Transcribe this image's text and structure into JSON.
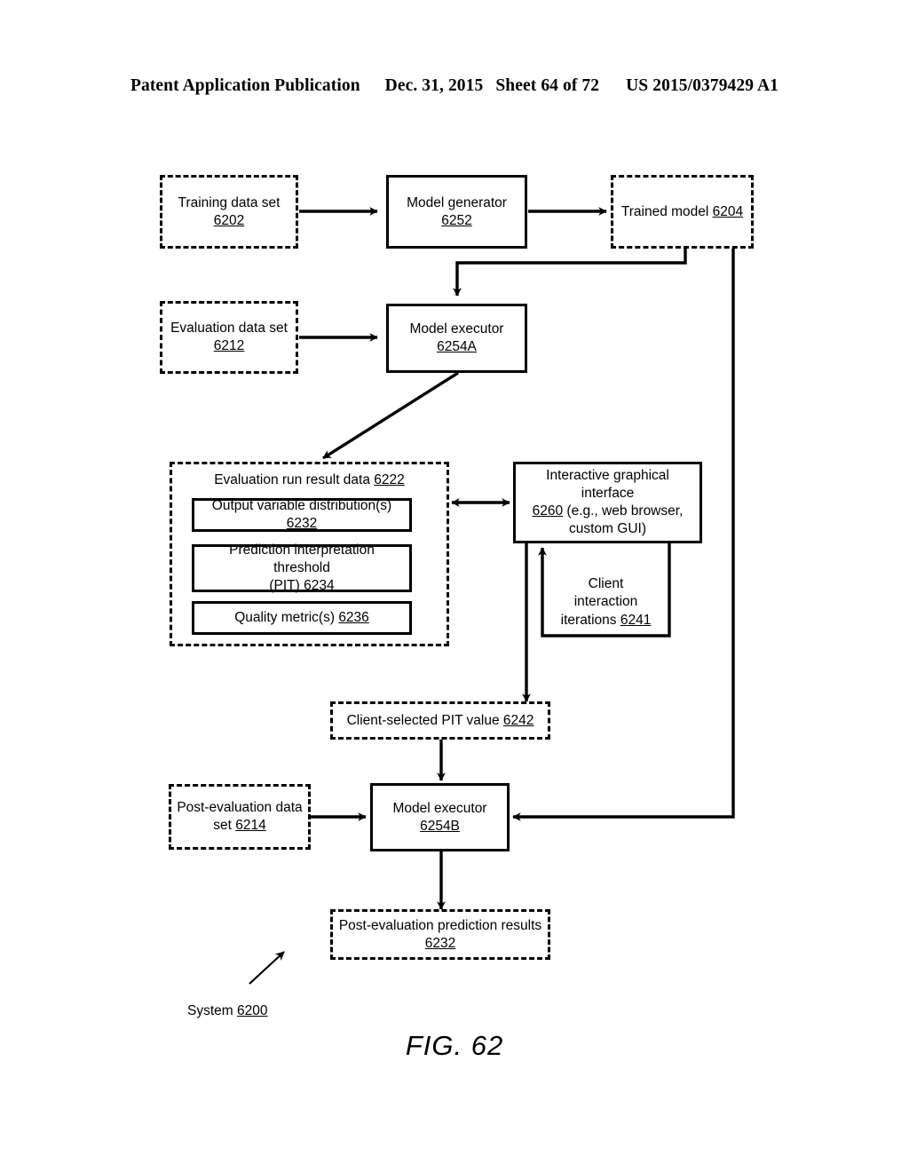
{
  "header": {
    "publication": "Patent Application Publication",
    "date": "Dec. 31, 2015",
    "sheet": "Sheet 64 of 72",
    "doc_number": "US 2015/0379429 A1"
  },
  "figure": {
    "caption": "FIG. 62",
    "system_label_text": "System ",
    "system_label_ref": "6200"
  },
  "nodes": {
    "training_data_set": {
      "text": "Training data set ",
      "ref": "6202",
      "style": "dashed"
    },
    "model_generator": {
      "text": "Model generator ",
      "ref": "6252",
      "style": "solid"
    },
    "trained_model": {
      "text": "Trained model ",
      "ref": "6204",
      "style": "dashed"
    },
    "evaluation_data_set": {
      "line1": "Evaluation data set",
      "ref": "6212",
      "style": "dashed"
    },
    "model_executor_a": {
      "text": "Model executor ",
      "ref": "6254A",
      "style": "solid"
    },
    "evaluation_run_result_data": {
      "text": "Evaluation run result data ",
      "ref": "6222",
      "style": "dashed"
    },
    "output_variable_distributions": {
      "text": "Output variable distribution(s) ",
      "ref": "6232",
      "style": "solid"
    },
    "prediction_interpretation_threshold": {
      "line1": "Prediction interpretation threshold",
      "line2": "(PIT) ",
      "ref": "6234",
      "style": "solid"
    },
    "quality_metrics": {
      "text": "Quality metric(s) ",
      "ref": "6236",
      "style": "solid"
    },
    "interactive_graphical_interface": {
      "line1": "Interactive graphical interface",
      "line2_ref": "6260",
      "line2_rest": " (e.g., web browser,",
      "line3": "custom GUI)",
      "style": "solid"
    },
    "client_interaction_iterations": {
      "line1": "Client",
      "line2": "interaction",
      "line3": "iterations ",
      "ref": "6241",
      "style": "loop-annotation"
    },
    "client_selected_pit_value": {
      "text": "Client-selected PIT value ",
      "ref": "6242",
      "style": "dashed"
    },
    "post_evaluation_data_set": {
      "line1": "Post-evaluation data",
      "line2": "set ",
      "ref": "6214",
      "style": "dashed"
    },
    "model_executor_b": {
      "text": "Model executor ",
      "ref": "6254B",
      "style": "solid"
    },
    "post_evaluation_prediction_results": {
      "line1": "Post-evaluation prediction results",
      "ref": "6232",
      "style": "dashed"
    }
  },
  "connections": [
    {
      "from": "training_data_set",
      "to": "model_generator",
      "kind": "arrow"
    },
    {
      "from": "model_generator",
      "to": "trained_model",
      "kind": "arrow"
    },
    {
      "from": "trained_model",
      "to": "model_executor_a",
      "kind": "arrow"
    },
    {
      "from": "trained_model",
      "to": "model_executor_b",
      "kind": "arrow"
    },
    {
      "from": "evaluation_data_set",
      "to": "model_executor_a",
      "kind": "arrow"
    },
    {
      "from": "model_executor_a",
      "to": "evaluation_run_result_data",
      "kind": "arrow"
    },
    {
      "from": "evaluation_run_result_data",
      "to": "interactive_graphical_interface",
      "kind": "double-arrow"
    },
    {
      "from": "interactive_graphical_interface",
      "to": "interactive_graphical_interface",
      "kind": "loop-arrow"
    },
    {
      "from": "interactive_graphical_interface",
      "to": "client_selected_pit_value",
      "kind": "arrow"
    },
    {
      "from": "client_selected_pit_value",
      "to": "model_executor_b",
      "kind": "arrow"
    },
    {
      "from": "post_evaluation_data_set",
      "to": "model_executor_b",
      "kind": "arrow"
    },
    {
      "from": "model_executor_b",
      "to": "post_evaluation_prediction_results",
      "kind": "arrow"
    },
    {
      "from": "system_label",
      "to": "diagram",
      "kind": "callout-arrow"
    }
  ],
  "colors": {
    "ink": "#000000",
    "paper": "#ffffff"
  }
}
